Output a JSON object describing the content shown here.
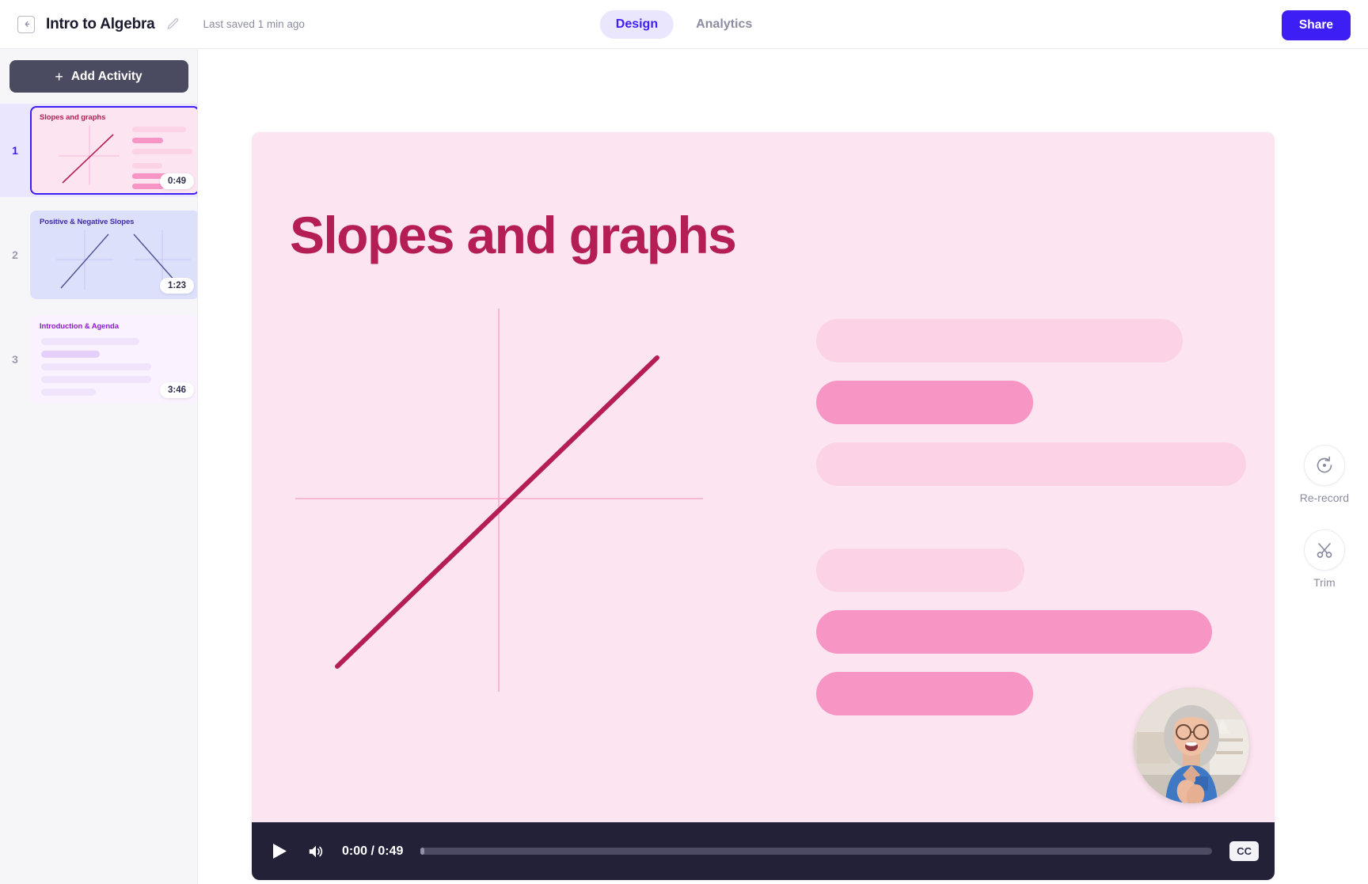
{
  "header": {
    "collapse_icon": "collapse-sidebar-icon",
    "title": "Intro to Algebra",
    "edit_icon": "pencil-icon",
    "saved_status": "Last saved 1 min ago",
    "tabs": [
      {
        "label": "Design",
        "active": true
      },
      {
        "label": "Analytics",
        "active": false
      }
    ],
    "share_label": "Share",
    "accent_color": "#3d1ef5",
    "tab_active_bg": "#e9e6fe"
  },
  "sidebar": {
    "add_activity_label": "Add Activity",
    "add_activity_icon": "plus-icon",
    "activities": [
      {
        "number": "1",
        "title": "Slopes and graphs",
        "duration": "0:49",
        "selected": true,
        "bg": "#fce4f0",
        "title_color": "#b51e55",
        "kind": "graph-bars"
      },
      {
        "number": "2",
        "title": "Positive & Negative Slopes",
        "duration": "1:23",
        "selected": false,
        "bg": "#dde0fb",
        "title_color": "#3d2ba8",
        "kind": "two-graphs"
      },
      {
        "number": "3",
        "title": "Introduction & Agenda",
        "duration": "3:46",
        "selected": false,
        "bg": "#faf2fe",
        "title_color": "#8f19d4",
        "kind": "bars"
      }
    ]
  },
  "slide": {
    "title": "Slopes and graphs",
    "bg_color": "#fce4f0",
    "title_color": "#b51e55",
    "axis_color": "#f8b9d7",
    "line_color": "#b51e55",
    "bar_light": "#fbd2e6",
    "bar_dark": "#f795c4",
    "webcam_alt": "presenter-video-bubble"
  },
  "player": {
    "play_icon": "play-icon",
    "volume_icon": "volume-icon",
    "time_display": "0:00 / 0:49",
    "current_time": "0:00",
    "total_time": "0:49",
    "progress_percent": 0,
    "cc_label": "CC"
  },
  "tools": [
    {
      "icon": "re-record-icon",
      "label": "Re-record"
    },
    {
      "icon": "scissors-icon",
      "label": "Trim"
    }
  ]
}
